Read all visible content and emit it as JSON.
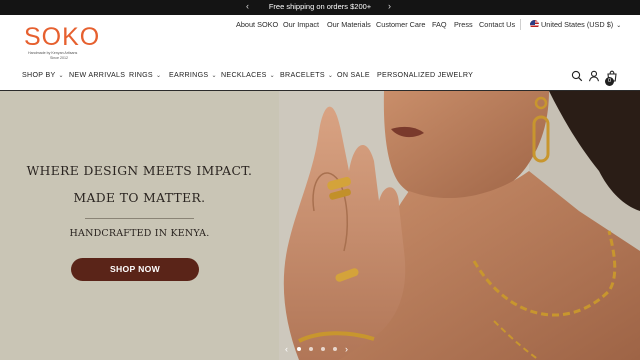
{
  "announcement": {
    "message": "Free shipping on orders $200+",
    "prev_icon": "chevron-left-icon",
    "next_icon": "chevron-right-icon"
  },
  "brand": {
    "name": "SOKO",
    "tagline_line1": "Handmade by Kenyan Artisans",
    "tagline_line2": "Since 2012",
    "color": "#e6602f"
  },
  "utility_nav": {
    "links": [
      "About SOKO",
      "Our Impact",
      "Our Materials",
      "Customer Care",
      "FAQ",
      "Press",
      "Contact Us"
    ],
    "currency": "United States (USD $)",
    "currency_icon": "us-flag-icon"
  },
  "main_nav": {
    "items": [
      {
        "label": "SHOP BY",
        "has_menu": true
      },
      {
        "label": "NEW ARRIVALS",
        "has_menu": false
      },
      {
        "label": "RINGS",
        "has_menu": true
      },
      {
        "label": "EARRINGS",
        "has_menu": true
      },
      {
        "label": "NECKLACES",
        "has_menu": true
      },
      {
        "label": "BRACELETS",
        "has_menu": true
      },
      {
        "label": "ON SALE",
        "has_menu": false
      },
      {
        "label": "PERSONALIZED JEWELRY",
        "has_menu": false
      }
    ],
    "icons": [
      "search-icon",
      "account-icon",
      "cart-icon"
    ],
    "cart_count": "0"
  },
  "hero": {
    "headline_line1": "WHERE DESIGN MEETS IMPACT.",
    "headline_line2": "MADE TO MATTER.",
    "subheadline": "HANDCRAFTED IN KENYA.",
    "cta_label": "SHOP NOW",
    "cta_color": "#5a2418",
    "panel_color": "#c9c5b5",
    "slide_count": 4,
    "active_slide": 1
  }
}
